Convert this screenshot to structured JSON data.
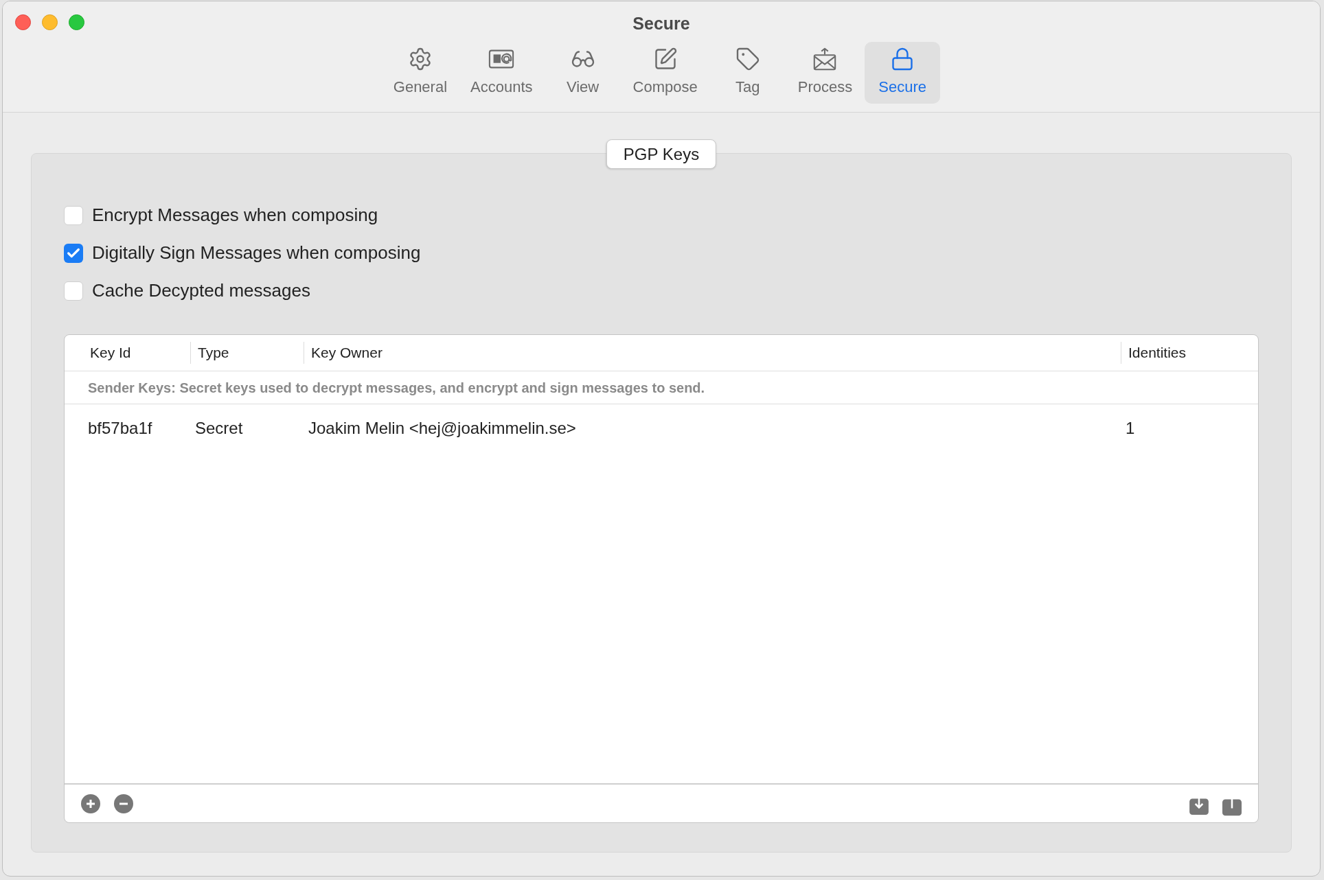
{
  "window": {
    "title": "Secure"
  },
  "toolbar": {
    "tabs": [
      {
        "label": "General",
        "selected": false
      },
      {
        "label": "Accounts",
        "selected": false
      },
      {
        "label": "View",
        "selected": false
      },
      {
        "label": "Compose",
        "selected": false
      },
      {
        "label": "Tag",
        "selected": false
      },
      {
        "label": "Process",
        "selected": false
      },
      {
        "label": "Secure",
        "selected": true
      }
    ]
  },
  "group": {
    "button": "PGP Keys",
    "options": [
      {
        "label": "Encrypt Messages when composing",
        "checked": false
      },
      {
        "label": "Digitally Sign Messages when composing",
        "checked": true
      },
      {
        "label": "Cache Decypted messages",
        "checked": false
      }
    ],
    "table": {
      "columns": [
        "Key Id",
        "Type",
        "Key Owner",
        "Identities"
      ],
      "section_note": "Sender Keys: Secret keys used to decrypt messages, and encrypt and sign messages to send.",
      "rows": [
        {
          "cells": [
            "bf57ba1f",
            "Secret",
            "Joakim Melin <hej@joakimmelin.se>",
            "1"
          ]
        }
      ]
    }
  }
}
